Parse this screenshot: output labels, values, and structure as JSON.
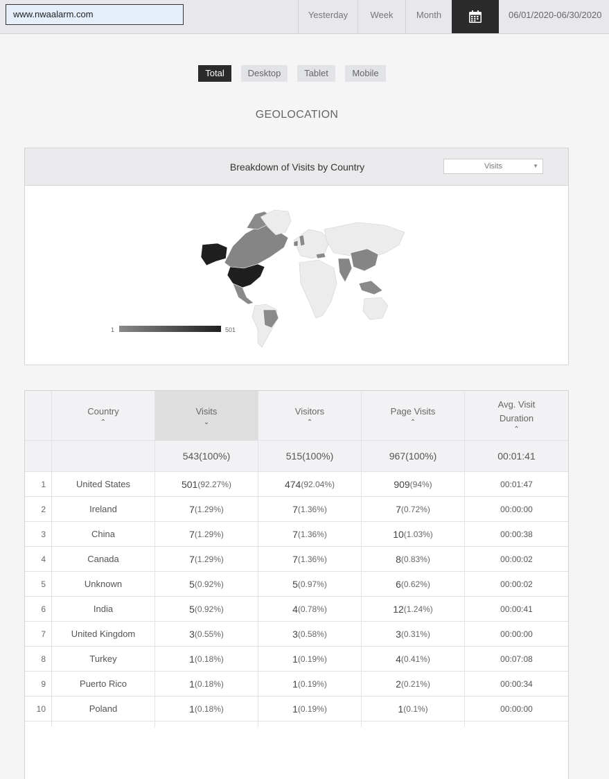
{
  "topbar": {
    "site": "www.nwaalarm.com",
    "ranges": [
      "Yesterday",
      "Week",
      "Month"
    ],
    "calendar_icon": "calendar-icon",
    "date_range": "06/01/2020-06/30/2020"
  },
  "device_tabs": [
    "Total",
    "Desktop",
    "Tablet",
    "Mobile"
  ],
  "active_device_tab": "Total",
  "section_title": "GEOLOCATION",
  "map": {
    "title": "Breakdown of Visits by Country",
    "metric": "Visits",
    "legend_min": "1",
    "legend_max": "501",
    "colors": {
      "max": "#1f1f1f",
      "min": "#8a8a8a",
      "none": "#ececec"
    }
  },
  "table": {
    "headers": {
      "country": "Country",
      "visits": "Visits",
      "visitors": "Visitors",
      "page_visits": "Page Visits",
      "duration": "Avg. Visit Duration"
    },
    "totals": {
      "visits": "543(100%)",
      "visitors": "515(100%)",
      "page_visits": "967(100%)",
      "duration": "00:01:41"
    },
    "rows": [
      {
        "idx": "1",
        "country": "United States",
        "visits": "501",
        "visits_pct": "(92.27%)",
        "visitors": "474",
        "visitors_pct": "(92.04%)",
        "pv": "909",
        "pv_pct": "(94%)",
        "duration": "00:01:47"
      },
      {
        "idx": "2",
        "country": "Ireland",
        "visits": "7",
        "visits_pct": "(1.29%)",
        "visitors": "7",
        "visitors_pct": "(1.36%)",
        "pv": "7",
        "pv_pct": "(0.72%)",
        "duration": "00:00:00"
      },
      {
        "idx": "3",
        "country": "China",
        "visits": "7",
        "visits_pct": "(1.29%)",
        "visitors": "7",
        "visitors_pct": "(1.36%)",
        "pv": "10",
        "pv_pct": "(1.03%)",
        "duration": "00:00:38"
      },
      {
        "idx": "4",
        "country": "Canada",
        "visits": "7",
        "visits_pct": "(1.29%)",
        "visitors": "7",
        "visitors_pct": "(1.36%)",
        "pv": "8",
        "pv_pct": "(0.83%)",
        "duration": "00:00:02"
      },
      {
        "idx": "5",
        "country": "Unknown",
        "visits": "5",
        "visits_pct": "(0.92%)",
        "visitors": "5",
        "visitors_pct": "(0.97%)",
        "pv": "6",
        "pv_pct": "(0.62%)",
        "duration": "00:00:02"
      },
      {
        "idx": "6",
        "country": "India",
        "visits": "5",
        "visits_pct": "(0.92%)",
        "visitors": "4",
        "visitors_pct": "(0.78%)",
        "pv": "12",
        "pv_pct": "(1.24%)",
        "duration": "00:00:41"
      },
      {
        "idx": "7",
        "country": "United Kingdom",
        "visits": "3",
        "visits_pct": "(0.55%)",
        "visitors": "3",
        "visitors_pct": "(0.58%)",
        "pv": "3",
        "pv_pct": "(0.31%)",
        "duration": "00:00:00"
      },
      {
        "idx": "8",
        "country": "Turkey",
        "visits": "1",
        "visits_pct": "(0.18%)",
        "visitors": "1",
        "visitors_pct": "(0.19%)",
        "pv": "4",
        "pv_pct": "(0.41%)",
        "duration": "00:07:08"
      },
      {
        "idx": "9",
        "country": "Puerto Rico",
        "visits": "1",
        "visits_pct": "(0.18%)",
        "visitors": "1",
        "visitors_pct": "(0.19%)",
        "pv": "2",
        "pv_pct": "(0.21%)",
        "duration": "00:00:34"
      },
      {
        "idx": "10",
        "country": "Poland",
        "visits": "1",
        "visits_pct": "(0.18%)",
        "visitors": "1",
        "visitors_pct": "(0.19%)",
        "pv": "1",
        "pv_pct": "(0.1%)",
        "duration": "00:00:00"
      }
    ]
  }
}
